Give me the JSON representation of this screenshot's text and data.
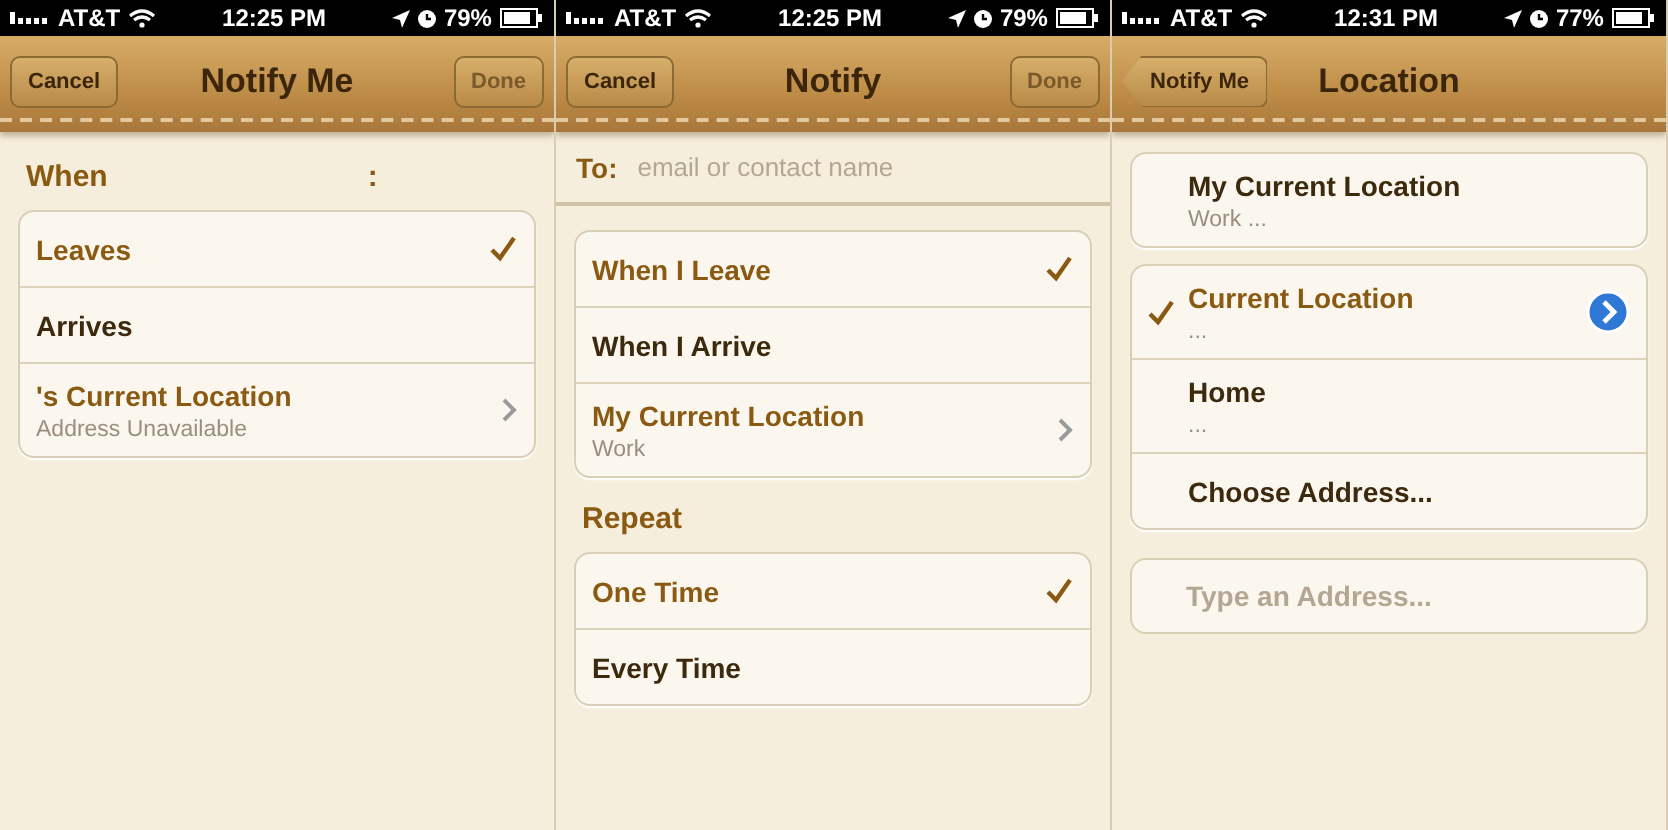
{
  "screens": [
    {
      "status": {
        "carrier": "AT&T",
        "time": "12:25 PM",
        "battery": "79%"
      },
      "nav": {
        "left_button": {
          "label": "Cancel",
          "kind": "plain"
        },
        "title": "Notify Me",
        "right_button": {
          "label": "Done",
          "disabled": true
        }
      },
      "sections": [
        {
          "kind": "header",
          "label": "When",
          "suffix": ":"
        },
        {
          "kind": "group",
          "rows": [
            {
              "kind": "option",
              "title": "Leaves",
              "selected": true
            },
            {
              "kind": "option",
              "title": "Arrives",
              "selected": false
            },
            {
              "kind": "link",
              "title": "'s Current Location",
              "subtitle": "Address Unavailable"
            }
          ]
        }
      ]
    },
    {
      "status": {
        "carrier": "AT&T",
        "time": "12:25 PM",
        "battery": "79%"
      },
      "nav": {
        "left_button": {
          "label": "Cancel",
          "kind": "plain"
        },
        "title": "Notify",
        "right_button": {
          "label": "Done",
          "disabled": true
        }
      },
      "sections": [
        {
          "kind": "to_field",
          "label": "To:",
          "placeholder": "email or contact name"
        },
        {
          "kind": "group",
          "rows": [
            {
              "kind": "option",
              "title": "When I Leave",
              "selected": true
            },
            {
              "kind": "option",
              "title": "When I Arrive",
              "selected": false
            },
            {
              "kind": "link",
              "title": "My Current Location",
              "subtitle": "Work"
            }
          ]
        },
        {
          "kind": "header",
          "label": "Repeat"
        },
        {
          "kind": "group",
          "rows": [
            {
              "kind": "option",
              "title": "One Time",
              "selected": true
            },
            {
              "kind": "option",
              "title": "Every Time",
              "selected": false
            }
          ]
        }
      ]
    },
    {
      "status": {
        "carrier": "AT&T",
        "time": "12:31 PM",
        "battery": "77%"
      },
      "nav": {
        "left_button": {
          "label": "Notify Me",
          "kind": "back"
        },
        "title": "Location"
      },
      "sections": [
        {
          "kind": "leading_check_group",
          "rows": [
            {
              "kind": "option",
              "title": "My Current Location",
              "subtitle": "Work ...",
              "selected": false
            }
          ]
        },
        {
          "kind": "leading_check_group",
          "rows": [
            {
              "kind": "option",
              "title": "Current Location",
              "subtitle": "...",
              "selected": true,
              "detail_button": true
            },
            {
              "kind": "option",
              "title": "Home",
              "subtitle": "...",
              "selected": false
            },
            {
              "kind": "action",
              "title": "Choose Address..."
            }
          ]
        },
        {
          "kind": "field",
          "placeholder": "Type an Address..."
        }
      ]
    }
  ]
}
